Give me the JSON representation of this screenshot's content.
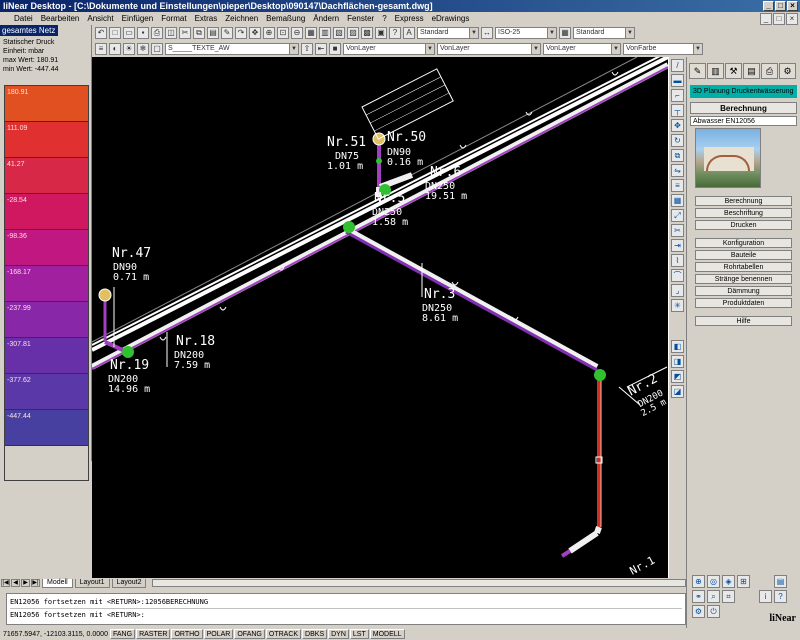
{
  "window": {
    "title": "liNear Desktop - [C:\\Dokumente und Einstellungen\\pieper\\Desktop\\090147\\Dachflächen-gesamt.dwg]"
  },
  "menu": [
    "Datei",
    "Bearbeiten",
    "Ansicht",
    "Einfügen",
    "Format",
    "Extras",
    "Zeichnen",
    "Bemaßung",
    "Ändern",
    "Fenster",
    "?",
    "Express",
    "eDrawings"
  ],
  "toolbar": {
    "style1": "Standard",
    "style2": "ISO-25",
    "style3": "Standard",
    "layer": "S_____TEXTE_AW",
    "color1": "VonLayer",
    "linetype": "VonLayer",
    "lineweight": "VonLayer",
    "plotstyle": "VonFarbe"
  },
  "legend": {
    "header": "gesamtes Netz",
    "label": "Statischer Druck",
    "unit": "Einheit: mbar",
    "max": "max Wert: 180.91",
    "min": "min Wert: -447.44",
    "values": [
      "180.91",
      "111.09",
      "41.27",
      "-28.54",
      "-98.36",
      "-168.17",
      "-237.99",
      "-307.81",
      "-377.62",
      "-447.44"
    ],
    "colors": [
      "#e05020",
      "#e03030",
      "#d82848",
      "#d01860",
      "#c01880",
      "#a020a0",
      "#8828a8",
      "#6830a8",
      "#5a38a8",
      "#4840a0"
    ]
  },
  "drawing": {
    "labels": [
      {
        "text": "Nr.51",
        "size": 13
      },
      {
        "text": "DN75",
        "size": 10
      },
      {
        "text": "1.01  m",
        "size": 10
      },
      {
        "text": "Nr.50",
        "size": 13
      },
      {
        "text": "DN90",
        "size": 10
      },
      {
        "text": "0.16  m",
        "size": 10
      },
      {
        "text": "Nr.6",
        "size": 13
      },
      {
        "text": "DN250",
        "size": 10
      },
      {
        "text": "19.51  m",
        "size": 10
      },
      {
        "text": "Nr.5",
        "size": 13
      },
      {
        "text": "DN250",
        "size": 10
      },
      {
        "text": "1.58  m",
        "size": 10
      },
      {
        "text": "Nr.47",
        "size": 13
      },
      {
        "text": "DN90",
        "size": 10
      },
      {
        "text": "0.71  m",
        "size": 10
      },
      {
        "text": "Nr.18",
        "size": 13
      },
      {
        "text": "DN200",
        "size": 10
      },
      {
        "text": "7.59  m",
        "size": 10
      },
      {
        "text": "Nr.19",
        "size": 13
      },
      {
        "text": "DN200",
        "size": 10
      },
      {
        "text": "14.96  m",
        "size": 10
      },
      {
        "text": "Nr.3",
        "size": 13
      },
      {
        "text": "DN250",
        "size": 10
      },
      {
        "text": "8.61  m",
        "size": 10
      },
      {
        "text": "Nr.2",
        "size": 13
      },
      {
        "text": "DN200",
        "size": 9
      },
      {
        "text": "2.5 m",
        "size": 9
      },
      {
        "text": "Nr.1",
        "size": 11
      }
    ]
  },
  "rightpanel": {
    "plan_button": "3D Planung Druckentwässerung",
    "header": "Berechnung",
    "norm": "Abwasser EN12056",
    "buttons": [
      "Berechnung",
      "Beschriftung",
      "Drucken",
      "Konfiguration",
      "Bauteile",
      "Rohrtabellen",
      "Stränge benennen",
      "Dämmung",
      "Produktdaten",
      "Hilfe"
    ],
    "logo": "liNear"
  },
  "tabs": [
    "Modell",
    "Layout1",
    "Layout2"
  ],
  "commandline": {
    "line1": "EN12056 fortsetzen mit <RETURN>:12056BERECHNUNG",
    "line2": "EN12056 fortsetzen mit <RETURN>:"
  },
  "status": {
    "coords": "71657.5947, -12103.3115, 0.0000",
    "toggles": [
      "FANG",
      "RASTER",
      "ORTHO",
      "POLAR",
      "OFANG",
      "OTRACK",
      "DBKS",
      "DYN",
      "LST",
      "MODELL"
    ]
  }
}
